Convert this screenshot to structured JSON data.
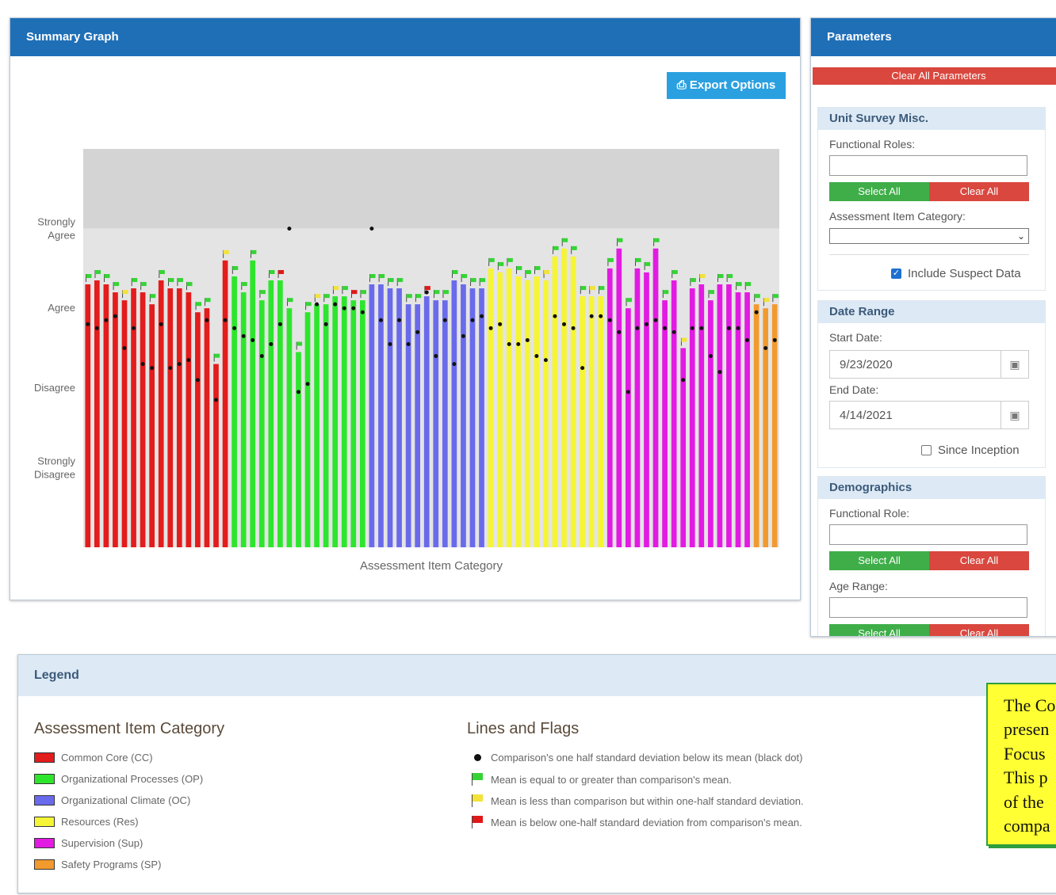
{
  "summary": {
    "title": "Summary Graph",
    "export_label": "Export Options"
  },
  "chart_data": {
    "type": "bar",
    "xlabel": "Assessment Item Category",
    "ylabel": "",
    "y_tick_labels": [
      "Strongly Agree",
      "Agree",
      "Disagree",
      "Strongly Disagree"
    ],
    "y_tick_values": [
      4,
      3,
      2,
      1
    ],
    "ylim": [
      0,
      5
    ],
    "colors": {
      "CC": "#e31c1c",
      "OP": "#2ee52e",
      "OC": "#6a6aec",
      "Res": "#f5f536",
      "Sup": "#e21be2",
      "SP": "#f29a2e"
    },
    "series": [
      {
        "name": "Common Core (CC)",
        "code": "CC",
        "means": [
          3.3,
          3.35,
          3.3,
          3.2,
          3.1,
          3.25,
          3.2,
          3.05,
          3.35,
          3.25,
          3.25,
          3.2,
          2.95,
          3.0,
          2.3,
          3.6
        ],
        "dots": [
          2.8,
          2.75,
          2.85,
          2.9,
          2.5,
          2.75,
          2.3,
          2.25,
          2.8,
          2.25,
          2.3,
          2.35,
          2.1,
          2.85,
          1.85,
          2.85
        ],
        "flags": [
          "green",
          "green",
          "green",
          "green",
          "yellow",
          "green",
          "green",
          "green",
          "green",
          "green",
          "green",
          "green",
          "green",
          "green",
          "green",
          "yellow"
        ]
      },
      {
        "name": "Organizational Processes (OP)",
        "code": "OP",
        "means": [
          3.4,
          3.2,
          3.6,
          3.1,
          3.35,
          3.35,
          3.0,
          2.45,
          2.95,
          3.05,
          3.05,
          3.15,
          3.15,
          3.1,
          3.1
        ],
        "dots": [
          2.75,
          2.65,
          2.6,
          2.4,
          2.55,
          2.8,
          4.0,
          1.95,
          2.05,
          3.05,
          2.8,
          3.05,
          3.0,
          3.0,
          2.95
        ],
        "flags": [
          "green",
          "green",
          "green",
          "green",
          "green",
          "red",
          "green",
          "green",
          "green",
          "yellow",
          "green",
          "yellow",
          "green",
          "red",
          "green"
        ]
      },
      {
        "name": "Organizational Climate (OC)",
        "code": "OC",
        "means": [
          3.3,
          3.3,
          3.25,
          3.25,
          3.05,
          3.05,
          3.15,
          3.1,
          3.1,
          3.35,
          3.3,
          3.25,
          3.25
        ],
        "dots": [
          4.0,
          2.85,
          2.55,
          2.85,
          2.55,
          2.7,
          3.2,
          2.4,
          2.85,
          2.3,
          2.65,
          2.85,
          2.9
        ],
        "flags": [
          "green",
          "green",
          "green",
          "green",
          "green",
          "green",
          "red",
          "green",
          "green",
          "green",
          "green",
          "green",
          "green"
        ]
      },
      {
        "name": "Resources (Res)",
        "code": "Res",
        "means": [
          3.5,
          3.45,
          3.5,
          3.4,
          3.35,
          3.4,
          3.35,
          3.65,
          3.75,
          3.65,
          3.15,
          3.15,
          3.15
        ],
        "dots": [
          2.75,
          2.8,
          2.55,
          2.55,
          2.6,
          2.4,
          2.35,
          2.9,
          2.8,
          2.75,
          2.25,
          2.9,
          2.9
        ],
        "flags": [
          "green",
          "green",
          "green",
          "green",
          "green",
          "green",
          "yellow",
          "green",
          "green",
          "green",
          "green",
          "yellow",
          "green"
        ]
      },
      {
        "name": "Supervision (Sup)",
        "code": "Sup",
        "means": [
          3.5,
          3.75,
          3.0,
          3.5,
          3.45,
          3.75,
          3.1,
          3.35,
          2.5,
          3.25,
          3.3,
          3.1,
          3.3,
          3.3,
          3.2,
          3.2
        ],
        "dots": [
          2.85,
          2.7,
          1.95,
          2.75,
          2.8,
          2.85,
          2.75,
          2.7,
          2.1,
          2.75,
          2.75,
          2.4,
          2.2,
          2.75,
          2.75,
          2.6
        ],
        "flags": [
          "green",
          "green",
          "green",
          "green",
          "green",
          "green",
          "green",
          "green",
          "yellow",
          "green",
          "yellow",
          "green",
          "green",
          "green",
          "green",
          "green"
        ]
      },
      {
        "name": "Safety Programs (SP)",
        "code": "SP",
        "means": [
          3.05,
          3.0,
          3.05
        ],
        "dots": [
          2.95,
          2.5,
          2.6
        ],
        "flags": [
          "green",
          "yellow",
          "green"
        ]
      }
    ]
  },
  "params": {
    "title": "Parameters",
    "clear_all": "Clear All Parameters",
    "unit_survey": {
      "title": "Unit Survey Misc.",
      "functional_roles_label": "Functional Roles:",
      "select_all": "Select All",
      "clear_all": "Clear All",
      "category_label": "Assessment Item Category:",
      "category_value": "",
      "suspect_label": "Include Suspect Data"
    },
    "date_range": {
      "title": "Date Range",
      "start_label": "Start Date:",
      "start_value": "9/23/2020",
      "end_label": "End Date:",
      "end_value": "4/14/2021",
      "since_label": "Since Inception"
    },
    "demographics": {
      "title": "Demographics",
      "functional_role_label": "Functional Role:",
      "select_all": "Select All",
      "clear_all": "Clear All",
      "age_label": "Age Range:",
      "select_all_2": "Select All",
      "clear_all_2": "Clear All"
    }
  },
  "legend": {
    "title": "Legend",
    "category_title": "Assessment Item Category",
    "categories": [
      {
        "label": "Common Core (CC)",
        "color": "#e31c1c"
      },
      {
        "label": "Organizational Processes (OP)",
        "color": "#2ee52e"
      },
      {
        "label": "Organizational Climate (OC)",
        "color": "#6a6aec"
      },
      {
        "label": "Resources (Res)",
        "color": "#f5f536"
      },
      {
        "label": "Supervision (Sup)",
        "color": "#e21be2"
      },
      {
        "label": "Safety Programs (SP)",
        "color": "#f29a2e"
      }
    ],
    "lines_title": "Lines and Flags",
    "lines": [
      {
        "icon": "black-dot",
        "label": "Comparison's one half standard deviation below its mean (black dot)"
      },
      {
        "icon": "green-flag",
        "label": "Mean is equal to or greater than comparison's mean."
      },
      {
        "icon": "yellow-flag",
        "label": "Mean is less than comparison but within one-half standard deviation."
      },
      {
        "icon": "red-flag",
        "label": "Mean is below one-half standard deviation from comparison's mean."
      }
    ]
  },
  "note": {
    "lines": [
      "The Co",
      "presen",
      "Focus",
      "This p",
      "of the",
      "compa"
    ]
  }
}
